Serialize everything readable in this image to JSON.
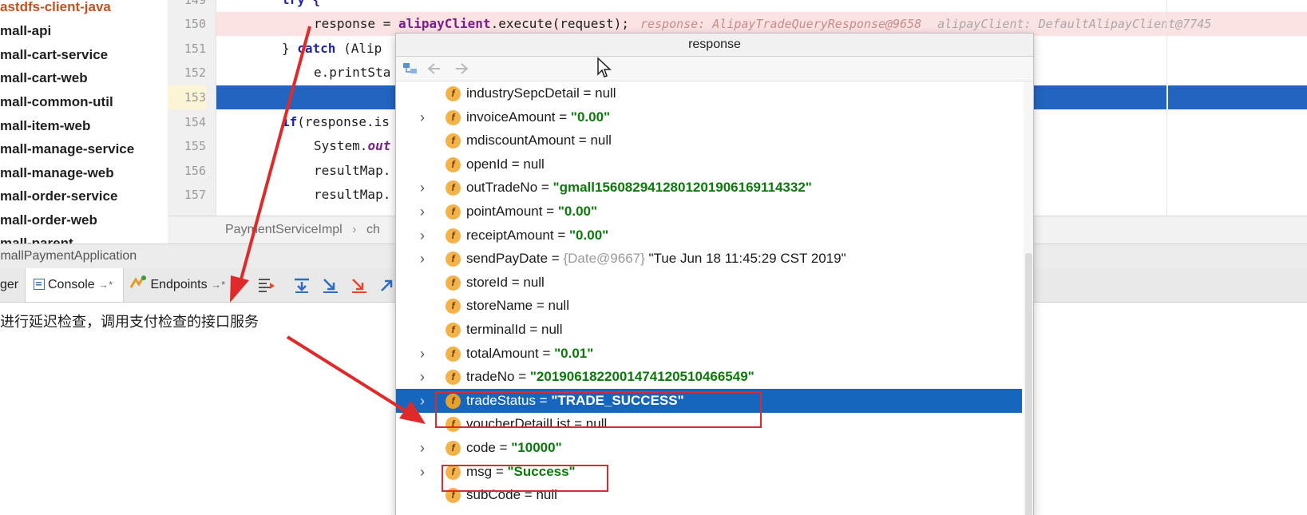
{
  "project_tree": {
    "items": [
      {
        "label": "astdfs-client-java",
        "color": "red"
      },
      {
        "label": "mall-api"
      },
      {
        "label": "mall-cart-service"
      },
      {
        "label": "mall-cart-web"
      },
      {
        "label": "mall-common-util"
      },
      {
        "label": "mall-item-web"
      },
      {
        "label": "mall-manage-service"
      },
      {
        "label": "mall-manage-web"
      },
      {
        "label": "mall-order-service"
      },
      {
        "label": "mall-order-web"
      },
      {
        "label": "mall-parent"
      }
    ]
  },
  "editor": {
    "lines": [
      {
        "num": "149"
      },
      {
        "num": "150"
      },
      {
        "num": "151"
      },
      {
        "num": "152"
      },
      {
        "num": "153"
      },
      {
        "num": "154"
      },
      {
        "num": "155"
      },
      {
        "num": "156"
      },
      {
        "num": "157"
      }
    ],
    "code": {
      "l149_try": "try {",
      "l150_response": "response = ",
      "l150_client": "alipayClient",
      "l150_rest": ".execute(request);",
      "l150_inline1": "response: AlipayTradeQueryResponse@9658",
      "l150_inline2": "alipayClient: DefaultAlipayClient@7745",
      "l151_close": "} ",
      "l151_catch": "catch",
      "l151_rest": " (Alip",
      "l152_text": "e.printSta",
      "l154_if": "if",
      "l154_rest": "(response.is",
      "l155_system": "System.",
      "l155_out": "out",
      "l156_text": "resultMap.",
      "l157_text": "resultMap."
    },
    "tab_text": "PaymentServiceImpl",
    "tab_arrow": "›",
    "tab_next": "ch"
  },
  "debug": {
    "app_title": "GmallPaymentApplication",
    "tab_debugger_suffix": "ger",
    "tab_console": "Console",
    "tab_console_pin": "→*",
    "tab_endpoints": "Endpoints",
    "tab_endpoints_pin": "→*",
    "console_output": "进行延迟检查，调用支付检查的接口服务"
  },
  "popup": {
    "title": "response",
    "rows": [
      {
        "expandable": false,
        "name": "industrySepcDetail",
        "eq": " = ",
        "value": "null",
        "type": "plain"
      },
      {
        "expandable": true,
        "name": "invoiceAmount",
        "eq": " = ",
        "value": "\"0.00\"",
        "type": "string"
      },
      {
        "expandable": false,
        "name": "mdiscountAmount",
        "eq": " = ",
        "value": "null",
        "type": "plain"
      },
      {
        "expandable": false,
        "name": "openId",
        "eq": " = ",
        "value": "null",
        "type": "plain"
      },
      {
        "expandable": true,
        "name": "outTradeNo",
        "eq": " = ",
        "value": "\"gmall1560829412801201906169114332\"",
        "type": "string"
      },
      {
        "expandable": true,
        "name": "pointAmount",
        "eq": " = ",
        "value": "\"0.00\"",
        "type": "string"
      },
      {
        "expandable": true,
        "name": "receiptAmount",
        "eq": " = ",
        "value": "\"0.00\"",
        "type": "string"
      },
      {
        "expandable": true,
        "name": "sendPayDate",
        "eq": " = ",
        "ref": "{Date@9667}",
        "value": " \"Tue Jun 18 11:45:29 CST 2019\"",
        "type": "ref"
      },
      {
        "expandable": false,
        "name": "storeId",
        "eq": " = ",
        "value": "null",
        "type": "plain"
      },
      {
        "expandable": false,
        "name": "storeName",
        "eq": " = ",
        "value": "null",
        "type": "plain"
      },
      {
        "expandable": false,
        "name": "terminalId",
        "eq": " = ",
        "value": "null",
        "type": "plain"
      },
      {
        "expandable": true,
        "name": "totalAmount",
        "eq": " = ",
        "value": "\"0.01\"",
        "type": "string"
      },
      {
        "expandable": true,
        "name": "tradeNo",
        "eq": " = ",
        "value": "\"2019061822001474120510466549\"",
        "type": "string"
      },
      {
        "expandable": true,
        "name": "tradeStatus",
        "eq": " = ",
        "value": "\"TRADE_SUCCESS\"",
        "type": "string",
        "selected": true
      },
      {
        "expandable": false,
        "name": "voucherDetailList",
        "eq": " = ",
        "value": "null",
        "type": "plain"
      },
      {
        "expandable": true,
        "name": "code",
        "eq": " = ",
        "value": "\"10000\"",
        "type": "string"
      },
      {
        "expandable": true,
        "name": "msg",
        "eq": " = ",
        "value": "\"Success\"",
        "type": "string"
      },
      {
        "expandable": false,
        "name": "subCode",
        "eq": " = ",
        "value": "null",
        "type": "plain"
      }
    ]
  },
  "icons": {
    "field_icon": "f",
    "expand_icon": "›",
    "breakpoint_icon": "✓"
  },
  "colors": {
    "selection_blue": "#1666be",
    "string_green": "#0b7a0b",
    "annotation_red": "#e02a2a",
    "field_icon_orange": "#f3b34a",
    "error_line_bg": "#fbe3e4"
  }
}
